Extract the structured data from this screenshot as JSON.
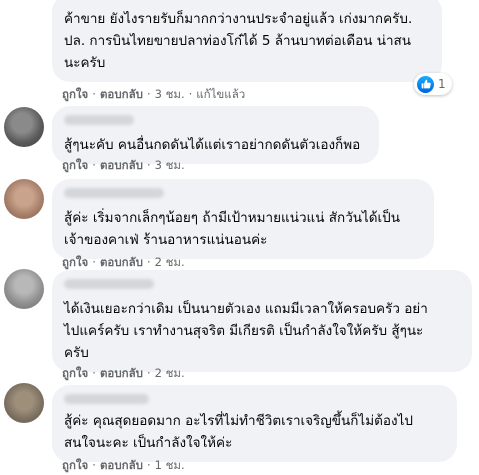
{
  "colors": {
    "bubble_bg": "#f0f2f5",
    "meta_text": "#65676b",
    "like_blue": "#1877f2"
  },
  "comments": [
    {
      "text": "ค้าขาย ยังไงรายรับก็มากกว่างานประจำอยู่แล้ว เก่งมากครับ.\nปล. การบินไทยขายปลาท่องโก๋ได้ 5 ล้านบาทต่อเดือน น่าสน\nนะครับ",
      "like": "ถูกใจ",
      "reply": "ตอบกลับ",
      "time": "3 ชม.",
      "edited": "แก้ไขแล้ว",
      "reaction": {
        "icon": "like-icon",
        "count": "1"
      }
    },
    {
      "text": "สู้ๆนะคับ คนอื่นกดดันได้แต่เราอย่ากดดันตัวเองก็พอ",
      "like": "ถูกใจ",
      "reply": "ตอบกลับ",
      "time": "3 ชม."
    },
    {
      "text": "สู้ค่ะ เริ่มจากเล็กๆน้อยๆ ถ้ามีเป้าหมายแน่วแน่ สักวันได้เป็น\nเจ้าของคาเฟ่ ร้านอาหารแน่นอนค่ะ",
      "like": "ถูกใจ",
      "reply": "ตอบกลับ",
      "time": "2 ชม."
    },
    {
      "text": "ได้เงินเยอะกว่าเดิม เป็นนายตัวเอง แถมมีเวลาให้ครอบครัว อย่า\nไปแคร์ครับ เราทำงานสุจริต มีเกียรติ เป็นกำลังใจให้ครับ สู้ๆนะ\nครับ",
      "like": "ถูกใจ",
      "reply": "ตอบกลับ",
      "time": "2 ชม."
    },
    {
      "text": "สู้ค่ะ คุณสุดยอดมาก อะไรที่ไม่ทำชีวิตเราเจริญขึ้นก็ไม่ต้องไป\nสนใจนะคะ เป็นกำลังใจให้ค่ะ",
      "like": "ถูกใจ",
      "reply": "ตอบกลับ",
      "time": "1 ชม."
    }
  ]
}
